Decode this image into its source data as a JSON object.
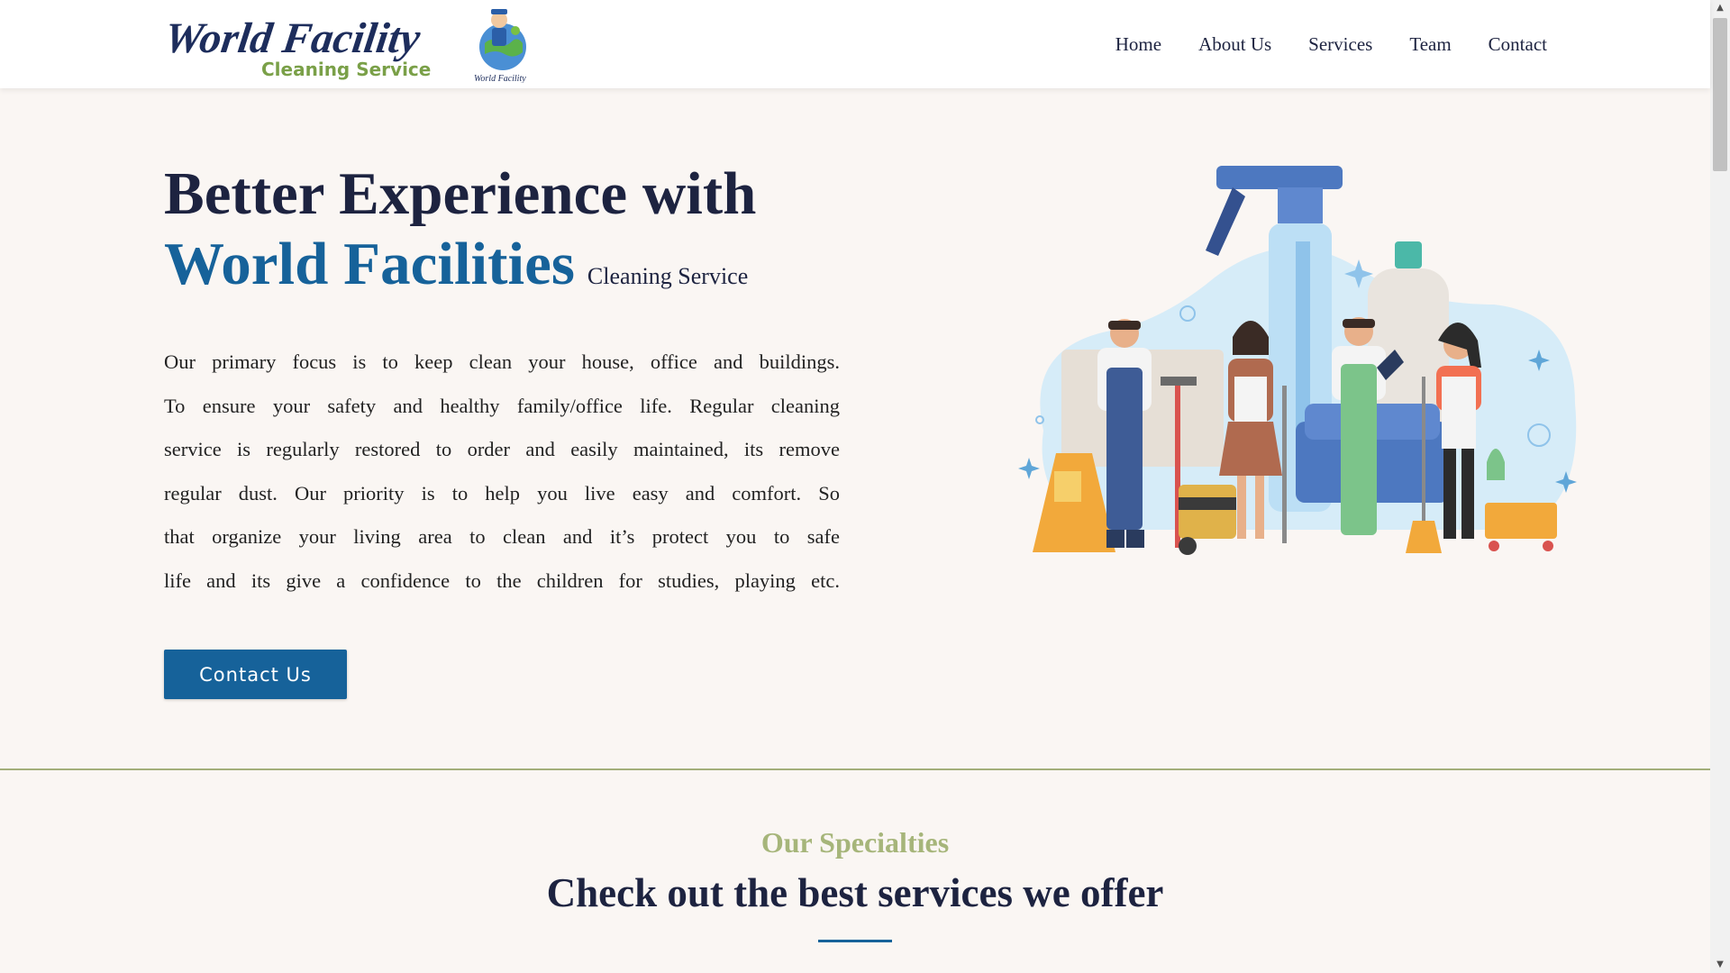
{
  "brand": {
    "logo_script": "World Facility",
    "logo_subtitle": "Cleaning Service",
    "mascot_caption": "World Facility"
  },
  "nav": {
    "items": [
      "Home",
      "About Us",
      "Services",
      "Team",
      "Contact"
    ]
  },
  "hero": {
    "title_line1": "Better Experience with",
    "title_accent": "World Facilities",
    "title_small": "Cleaning Service",
    "paragraph_lines": [
      "Our primary focus is to keep clean your house, office and buildings.",
      "To ensure your safety and healthy family/office life. Regular cleaning",
      "service is regularly restored to order and easily maintained, its remove",
      "regular dust. Our priority is to help you live easy and comfort. So",
      "that organize your living area to clean and it’s protect you to safe",
      "life and its give a confidence to the children for studies, playing etc."
    ],
    "cta_label": "Contact Us"
  },
  "specialties": {
    "label": "Our Specialties",
    "title": "Check out the best services we offer"
  },
  "colors": {
    "accent": "#16629a",
    "dark": "#1d2340",
    "olive": "#a6b57a",
    "background": "#faf6f3"
  }
}
